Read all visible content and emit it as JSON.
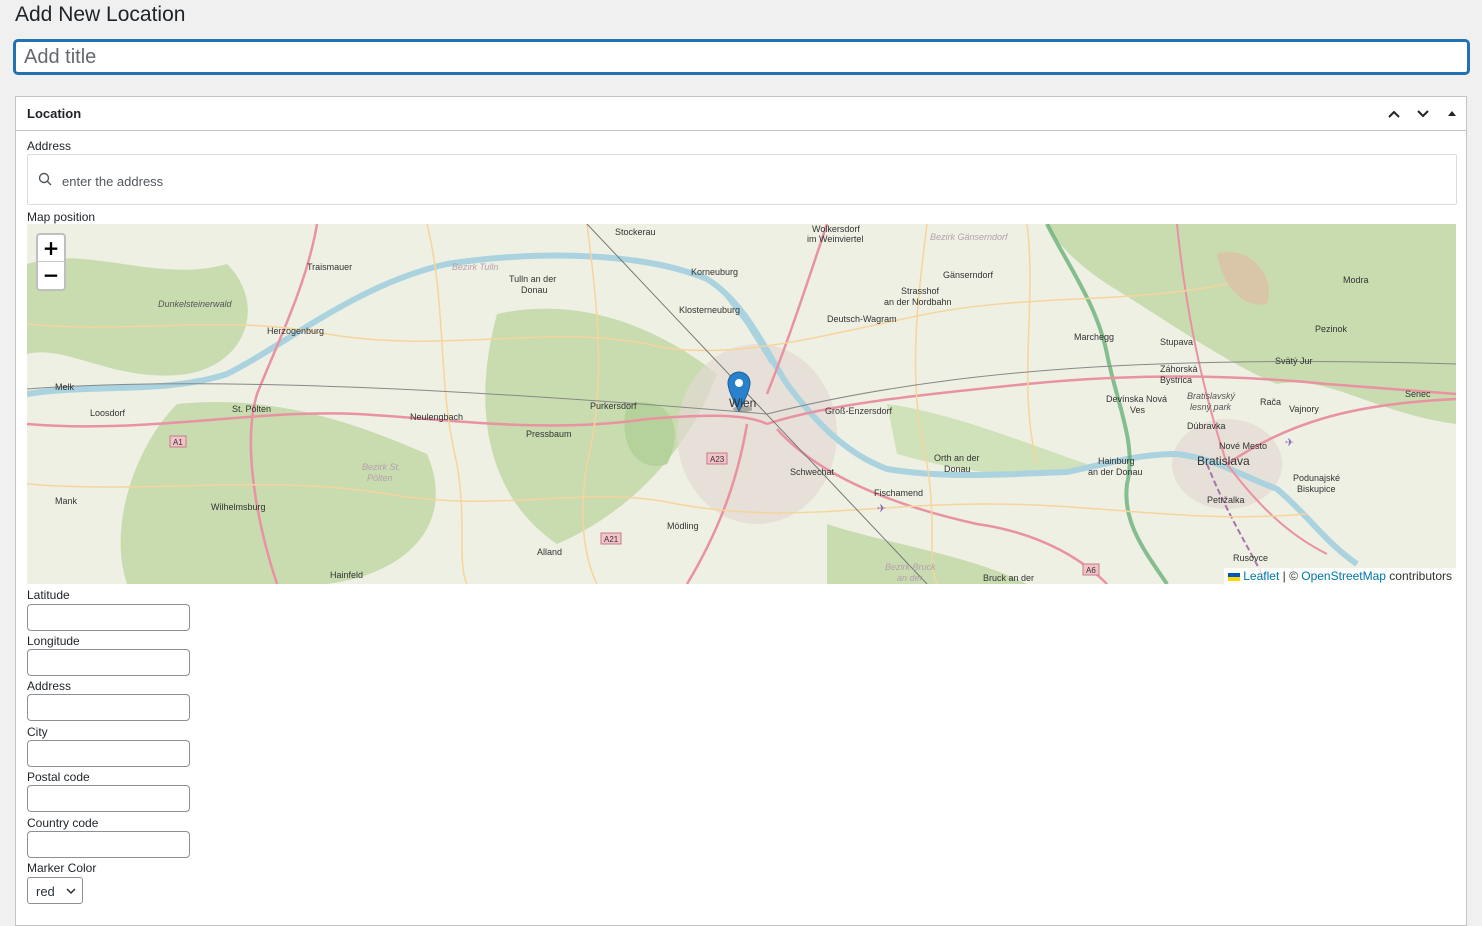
{
  "page": {
    "title": "Add New Location",
    "title_placeholder": "Add title"
  },
  "metabox": {
    "title": "Location",
    "controls": [
      "move-up-icon",
      "move-down-icon",
      "toggle-panel-icon"
    ]
  },
  "address_search": {
    "label": "Address",
    "placeholder": "enter the address"
  },
  "map": {
    "label": "Map position",
    "zoom_in": "+",
    "zoom_out": "−",
    "marker_label": "Wien",
    "attribution": {
      "leaflet": "Leaflet",
      "separator": " | © ",
      "osm": "OpenStreetMap",
      "suffix": " contributors"
    },
    "place_names": [
      "Stockerau",
      "Wolkersdorf",
      "im Weinviertel",
      "Bezirk Gänserndorf",
      "Traismauer",
      "Bezirk Tulln",
      "Tulln an der",
      "Donau",
      "Korneuburg",
      "Gänserndorf",
      "Strasshof",
      "an der Nordbahn",
      "Dunkelsteinerwald",
      "Herzogenburg",
      "Klosterneuburg",
      "Deutsch-Wagram",
      "Marchegg",
      "Stupava",
      "Záhorská",
      "Bystrica",
      "Modra",
      "Pezinok",
      "Svätý Jur",
      "Melk",
      "Loosdorf",
      "St. Pölten",
      "Neulengbach",
      "Purkersdorf",
      "Groß-Enzersdorf",
      "Devínska Nová",
      "Ves",
      "Bratislavský",
      "lesný park",
      "Rača",
      "Vajnory",
      "Senec",
      "A1",
      "Pressbaum",
      "Dúbravka",
      "Nové Mesto",
      "Bratislava",
      "A23",
      "Schwechat",
      "Orth an der",
      "Donau",
      "Hainburg",
      "an der Donau",
      "Bezirk St.",
      "Pölten",
      "Podunajské",
      "Biskupice",
      "Mank",
      "Wilhelmsburg",
      "Fischamend",
      "Petržalka",
      "Mödling",
      "A21",
      "Alland",
      "Rusovce",
      "Hainfeld",
      "Bezirk Bruck",
      "an der",
      "Bruck an der",
      "A6"
    ]
  },
  "fields": {
    "latitude": {
      "label": "Latitude",
      "value": ""
    },
    "longitude": {
      "label": "Longitude",
      "value": ""
    },
    "address": {
      "label": "Address",
      "value": ""
    },
    "city": {
      "label": "City",
      "value": ""
    },
    "postal_code": {
      "label": "Postal code",
      "value": ""
    },
    "country_code": {
      "label": "Country code",
      "value": ""
    },
    "marker_color": {
      "label": "Marker Color",
      "selected": "red"
    }
  },
  "colors": {
    "accent": "#2271b1",
    "marker": "#2a81cb",
    "link": "#0078a8",
    "river": "#aad3df",
    "forest": "#c8dcb0",
    "road_major": "#e892a2",
    "road_minor": "#f7d49c",
    "border": "#58a86a"
  }
}
